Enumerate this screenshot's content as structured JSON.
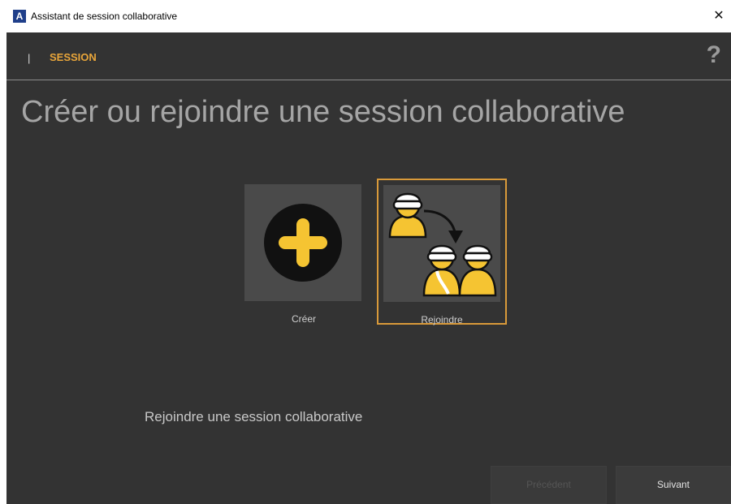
{
  "window": {
    "logo_letter": "A",
    "title": "Assistant de session collaborative",
    "close_glyph": "✕"
  },
  "header": {
    "separator": "|",
    "breadcrumb": "SESSION",
    "help_glyph": "?"
  },
  "main": {
    "title": "Créer ou rejoindre une session collaborative",
    "options": [
      {
        "label": "Créer",
        "icon": "plus-icon",
        "selected": false
      },
      {
        "label": "Rejoindre",
        "icon": "join-session-icon",
        "selected": true
      }
    ],
    "description": "Rejoindre une session collaborative"
  },
  "footer": {
    "previous_label": "Précédent",
    "next_label": "Suivant"
  },
  "colors": {
    "background": "#333333",
    "accent": "#d99a3a",
    "icon_yellow": "#f5c432"
  }
}
